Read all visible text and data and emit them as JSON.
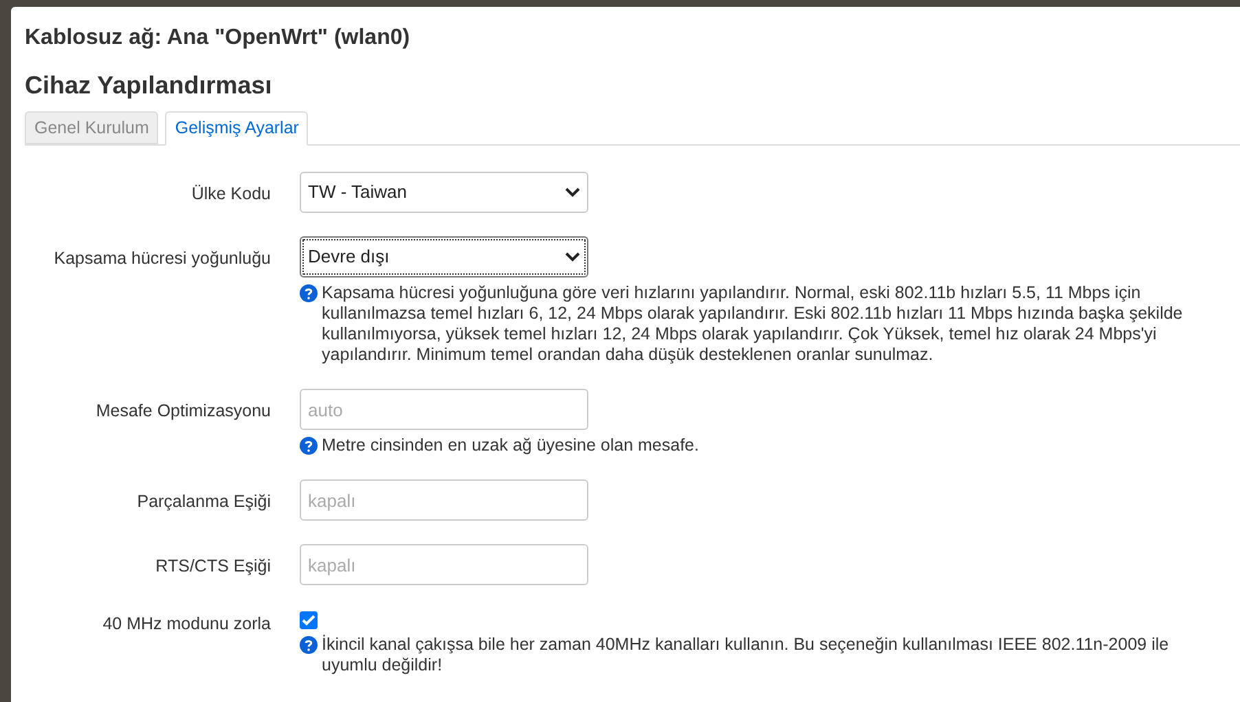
{
  "modal": {
    "title": "Kablosuz ağ: Ana \"OpenWrt\" (wlan0)",
    "section_title": "Cihaz Yapılandırması",
    "tabs": [
      {
        "label": "Genel Kurulum",
        "selected": false
      },
      {
        "label": "Gelişmiş Ayarlar",
        "selected": true
      }
    ],
    "fields": [
      {
        "kind": "select",
        "label": "Ülke Kodu",
        "value": "TW - Taiwan",
        "focused": false
      },
      {
        "kind": "select",
        "label": "Kapsama hücresi yoğunluğu",
        "value": "Devre dışı",
        "focused": true,
        "help": "Kapsama hücresi yoğunluğuna göre veri hızlarını yapılandırır. Normal, eski 802.11b hızları 5.5, 11 Mbps için kullanılmazsa temel hızları 6, 12, 24 Mbps olarak yapılandırır. Eski 802.11b hızları 11 Mbps hızında başka şekilde kullanılmıyorsa, yüksek temel hızları 12, 24 Mbps olarak yapılandırır. Çok Yüksek, temel hız olarak 24 Mbps'yi yapılandırır. Minimum temel orandan daha düşük desteklenen oranlar sunulmaz."
      },
      {
        "kind": "input",
        "label": "Mesafe Optimizasyonu",
        "placeholder": "auto",
        "help": "Metre cinsinden en uzak ağ üyesine olan mesafe."
      },
      {
        "kind": "input",
        "label": "Parçalanma Eşiği",
        "placeholder": "kapalı"
      },
      {
        "kind": "input",
        "label": "RTS/CTS Eşiği",
        "placeholder": "kapalı"
      },
      {
        "kind": "checkbox",
        "label": "40 MHz modunu zorla",
        "checked": true,
        "help": "İkincil kanal çakışsa bile her zaman 40MHz kanalları kullanın. Bu seçeneğin kullanılması IEEE 802.11n-2009 ile uyumlu değildir!"
      }
    ]
  }
}
